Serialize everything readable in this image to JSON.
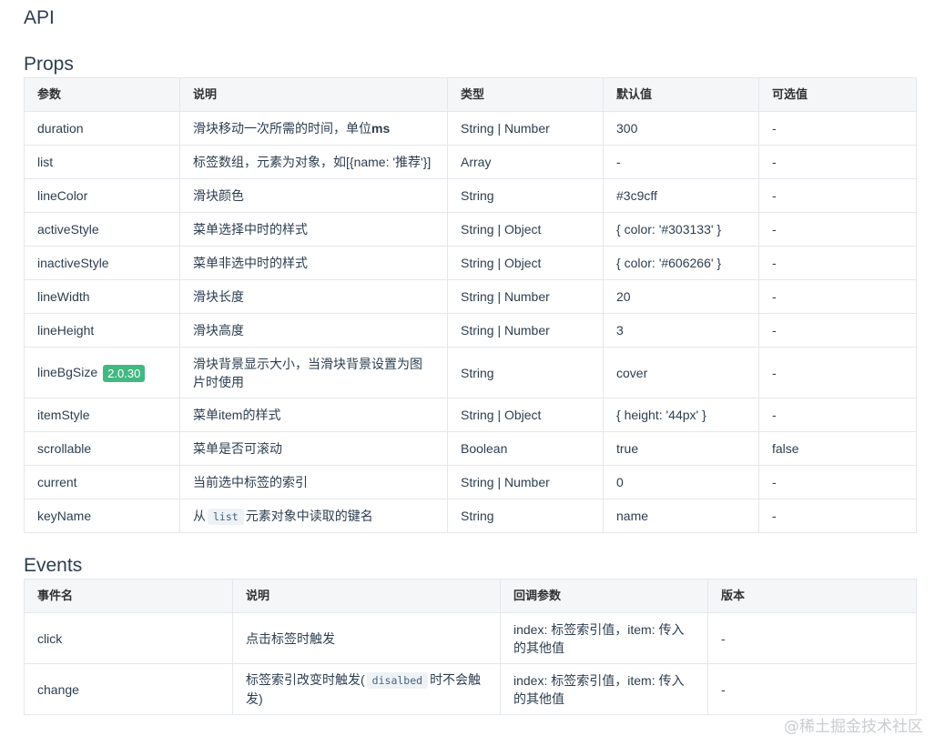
{
  "api_title": "API",
  "props": {
    "title": "Props",
    "headers": [
      "参数",
      "说明",
      "类型",
      "默认值",
      "可选值"
    ],
    "rows": [
      {
        "name": "duration",
        "desc_prefix": "滑块移动一次所需的时间，单位",
        "desc_bold": "ms",
        "type": "String | Number",
        "default": "300",
        "options": "-"
      },
      {
        "name": "list",
        "desc": "标签数组，元素为对象，如[{name: '推荐'}]",
        "type": "Array",
        "default": "-",
        "options": "-"
      },
      {
        "name": "lineColor",
        "desc": "滑块颜色",
        "type": "String",
        "default": "#3c9cff",
        "options": "-"
      },
      {
        "name": "activeStyle",
        "desc": "菜单选择中时的样式",
        "type": "String | Object",
        "default": "{ color: '#303133' }",
        "options": "-"
      },
      {
        "name": "inactiveStyle",
        "desc": "菜单非选中时的样式",
        "type": "String | Object",
        "default": "{ color: '#606266' }",
        "options": "-"
      },
      {
        "name": "lineWidth",
        "desc": "滑块长度",
        "type": "String | Number",
        "default": "20",
        "options": "-"
      },
      {
        "name": "lineHeight",
        "desc": "滑块高度",
        "type": "String | Number",
        "default": "3",
        "options": "-"
      },
      {
        "name": "lineBgSize",
        "badge": "2.0.30",
        "desc": "滑块背景显示大小，当滑块背景设置为图片时使用",
        "type": "String",
        "default": "cover",
        "options": "-"
      },
      {
        "name": "itemStyle",
        "desc": "菜单item的样式",
        "type": "String | Object",
        "default": "{ height: '44px' }",
        "options": "-"
      },
      {
        "name": "scrollable",
        "desc": "菜单是否可滚动",
        "type": "Boolean",
        "default": "true",
        "options": "false"
      },
      {
        "name": "current",
        "desc": "当前选中标签的索引",
        "type": "String | Number",
        "default": "0",
        "options": "-"
      },
      {
        "name": "keyName",
        "desc_prefix": "从",
        "desc_code": "list",
        "desc_suffix": "元素对象中读取的键名",
        "type": "String",
        "default": "name",
        "options": "-"
      }
    ]
  },
  "events": {
    "title": "Events",
    "headers": [
      "事件名",
      "说明",
      "回调参数",
      "版本"
    ],
    "rows": [
      {
        "name": "click",
        "desc": "点击标签时触发",
        "params": "index: 标签索引值，item: 传入的其他值",
        "version": "-"
      },
      {
        "name": "change",
        "desc_prefix": "标签索引改变时触发(",
        "desc_code": "disalbed",
        "desc_suffix": "时不会触发)",
        "params": "index: 标签索引值，item: 传入的其他值",
        "version": "-"
      }
    ]
  },
  "watermark": "@稀土掘金技术社区"
}
